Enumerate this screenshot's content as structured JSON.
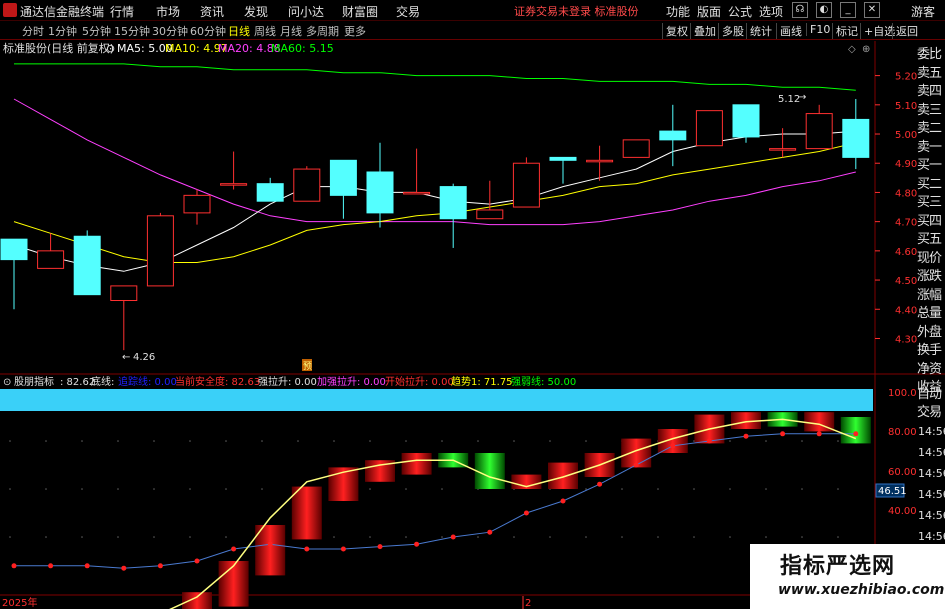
{
  "app": {
    "title": "通达信金融终端"
  },
  "menu": {
    "items": [
      "行情",
      "市场",
      "资讯",
      "发现",
      "问小达",
      "财富圈",
      "交易"
    ],
    "notice": "证券交易未登录  标准股份",
    "right_items": [
      "功能",
      "版面",
      "公式",
      "选项"
    ],
    "guest": "游客"
  },
  "toolbar": {
    "timeframes": [
      "分时",
      "1分钟",
      "5分钟",
      "15分钟",
      "30分钟",
      "60分钟",
      "日线",
      "周线",
      "月线",
      "多周期",
      "更多"
    ],
    "active_timeframe": "日线",
    "right_buttons": [
      "复权",
      "叠加",
      "多股",
      "统计",
      "画线",
      "F10",
      "标记",
      "+自选",
      "返回"
    ]
  },
  "main_chart": {
    "title": "标准股份(日线 前复权)",
    "ma": [
      {
        "label": "MA5: 5.00",
        "color": "#ffffff"
      },
      {
        "label": "MA10: 4.97",
        "color": "#ffff00"
      },
      {
        "label": "MA20: 4.88",
        "color": "#ff40ff"
      },
      {
        "label": "MA60: 5.15",
        "color": "#00ff00"
      }
    ],
    "price_ticks": [
      "5.20",
      "5.10",
      "5.00",
      "4.90",
      "4.80",
      "4.70",
      "4.60",
      "4.50",
      "4.40",
      "4.30"
    ],
    "high_label": "5.12",
    "low_label": "4.26",
    "event_marker": "预"
  },
  "indicator": {
    "name": "股朋指标",
    "value": ": 82.62",
    "items": [
      {
        "label": "底线:",
        "color": "#e0e0e0"
      },
      {
        "label": "追踪线: 0.00",
        "color": "#2020ff"
      },
      {
        "label": "当前安全度: 82.63",
        "color": "#ff3030"
      },
      {
        "label": "强拉升: 0.00",
        "color": "#e0e0e0"
      },
      {
        "label": "加强拉升: 0.00",
        "color": "#ff40ff"
      },
      {
        "label": "开始拉升: 0.00",
        "color": "#ff3030"
      },
      {
        "label": "趋势1: 71.75",
        "color": "#ffff00"
      },
      {
        "label": "强弱线: 50.00",
        "color": "#00ff00"
      }
    ],
    "ticks": [
      "100.0",
      "80.00",
      "60.00",
      "40.00"
    ],
    "current": "46.51"
  },
  "date_labels": [
    "2025年",
    "2"
  ],
  "right_panel": [
    "委比",
    "卖五",
    "卖四",
    "卖三",
    "卖二",
    "卖一",
    "买一",
    "买二",
    "买三",
    "买四",
    "买五",
    "现价",
    "涨跌",
    "涨幅",
    "总量",
    "外盘",
    "换手",
    "净资",
    "收益"
  ],
  "right_panel_lower": [
    "自动",
    "交易"
  ],
  "time_labels": [
    "14:56",
    "14:56",
    "14:56",
    "14:56",
    "14:56",
    "14:56",
    "14:56"
  ],
  "watermark": {
    "title": "指标严选网",
    "url": "www.xuezhibiao.com"
  },
  "colors": {
    "up": "#ff3030",
    "down": "#54ffff",
    "bg": "#000000",
    "grid": "#800000"
  },
  "chart_data": {
    "type": "candlestick",
    "candles": [
      {
        "o": 4.64,
        "h": 4.64,
        "l": 4.4,
        "c": 4.57
      },
      {
        "o": 4.54,
        "h": 4.66,
        "l": 4.54,
        "c": 4.6
      },
      {
        "o": 4.65,
        "h": 4.67,
        "l": 4.45,
        "c": 4.45
      },
      {
        "o": 4.43,
        "h": 4.48,
        "l": 4.26,
        "c": 4.48
      },
      {
        "o": 4.48,
        "h": 4.73,
        "l": 4.48,
        "c": 4.72
      },
      {
        "o": 4.73,
        "h": 4.81,
        "l": 4.69,
        "c": 4.79
      },
      {
        "o": 4.83,
        "h": 4.94,
        "l": 4.81,
        "c": 4.83
      },
      {
        "o": 4.83,
        "h": 4.85,
        "l": 4.77,
        "c": 4.77
      },
      {
        "o": 4.77,
        "h": 4.89,
        "l": 4.77,
        "c": 4.88
      },
      {
        "o": 4.91,
        "h": 4.91,
        "l": 4.71,
        "c": 4.79
      },
      {
        "o": 4.87,
        "h": 4.97,
        "l": 4.68,
        "c": 4.73
      },
      {
        "o": 4.8,
        "h": 4.95,
        "l": 4.8,
        "c": 4.8
      },
      {
        "o": 4.82,
        "h": 4.83,
        "l": 4.61,
        "c": 4.71
      },
      {
        "o": 4.71,
        "h": 4.84,
        "l": 4.71,
        "c": 4.74
      },
      {
        "o": 4.75,
        "h": 4.92,
        "l": 4.75,
        "c": 4.9
      },
      {
        "o": 4.92,
        "h": 4.92,
        "l": 4.83,
        "c": 4.91
      },
      {
        "o": 4.91,
        "h": 4.96,
        "l": 4.84,
        "c": 4.91
      },
      {
        "o": 4.92,
        "h": 4.98,
        "l": 4.92,
        "c": 4.98
      },
      {
        "o": 5.01,
        "h": 5.1,
        "l": 4.89,
        "c": 4.98
      },
      {
        "o": 4.96,
        "h": 5.08,
        "l": 4.96,
        "c": 5.08
      },
      {
        "o": 5.1,
        "h": 5.1,
        "l": 4.97,
        "c": 4.99
      },
      {
        "o": 4.95,
        "h": 5.02,
        "l": 4.92,
        "c": 4.95
      },
      {
        "o": 4.95,
        "h": 5.1,
        "l": 4.95,
        "c": 5.07
      },
      {
        "o": 5.05,
        "h": 5.12,
        "l": 4.88,
        "c": 4.92
      }
    ],
    "ma5": [
      4.62,
      4.58,
      4.55,
      4.53,
      4.56,
      4.62,
      4.68,
      4.76,
      4.82,
      4.82,
      4.8,
      4.8,
      4.77,
      4.76,
      4.78,
      4.82,
      4.85,
      4.88,
      4.94,
      4.97,
      4.99,
      5.0,
      5.0,
      5.01
    ],
    "ma10": [
      4.7,
      4.66,
      4.62,
      4.58,
      4.56,
      4.56,
      4.58,
      4.62,
      4.67,
      4.69,
      4.7,
      4.72,
      4.73,
      4.75,
      4.77,
      4.79,
      4.82,
      4.83,
      4.86,
      4.88,
      4.9,
      4.92,
      4.94,
      4.97
    ],
    "ma20": [
      5.12,
      5.05,
      4.98,
      4.92,
      4.86,
      4.81,
      4.76,
      4.72,
      4.7,
      4.7,
      4.7,
      4.7,
      4.7,
      4.69,
      4.69,
      4.69,
      4.7,
      4.72,
      4.74,
      4.77,
      4.79,
      4.82,
      4.84,
      4.87
    ],
    "ma60": [
      5.24,
      5.24,
      5.24,
      5.24,
      5.23,
      5.23,
      5.22,
      5.22,
      5.22,
      5.21,
      5.21,
      5.2,
      5.2,
      5.2,
      5.19,
      5.19,
      5.18,
      5.18,
      5.18,
      5.17,
      5.17,
      5.16,
      5.16,
      5.15
    ],
    "ylim": [
      4.24,
      5.25
    ],
    "indicator_bars": [
      {
        "v": 8,
        "c": "red"
      },
      {
        "v": 8,
        "c": "red"
      },
      {
        "v": 8,
        "c": "red"
      },
      {
        "v": 8,
        "c": "red"
      },
      {
        "v": 8,
        "c": "red"
      },
      {
        "v": 14,
        "c": "grad"
      },
      {
        "v": 27,
        "c": "grad"
      },
      {
        "v": 42,
        "c": "grad"
      },
      {
        "v": 58,
        "c": "grad"
      },
      {
        "v": 66,
        "c": "grad"
      },
      {
        "v": 69,
        "c": "grad"
      },
      {
        "v": 72,
        "c": "grad"
      },
      {
        "v": 72,
        "c": "green"
      },
      {
        "v": 63,
        "c": "green"
      },
      {
        "v": 63,
        "c": "grad"
      },
      {
        "v": 68,
        "c": "grad"
      },
      {
        "v": 72,
        "c": "grad"
      },
      {
        "v": 78,
        "c": "grad"
      },
      {
        "v": 82,
        "c": "grad"
      },
      {
        "v": 88,
        "c": "grad"
      },
      {
        "v": 89,
        "c": "grad"
      },
      {
        "v": 89,
        "c": "green"
      },
      {
        "v": 87,
        "c": "grad"
      },
      {
        "v": 82,
        "c": "green"
      }
    ],
    "blue_line": [
      28,
      28,
      28,
      27,
      28,
      30,
      35,
      37,
      35,
      35,
      36,
      37,
      40,
      42,
      50,
      55,
      62,
      70,
      78,
      80,
      82,
      83,
      83,
      83
    ],
    "yellow_line": [
      8,
      8,
      8,
      8,
      8,
      15,
      28,
      48,
      63,
      67,
      70,
      72,
      72,
      65,
      61,
      65,
      70,
      76,
      81,
      85,
      88,
      89,
      87,
      81
    ],
    "ind_ylim": [
      0,
      100
    ]
  }
}
